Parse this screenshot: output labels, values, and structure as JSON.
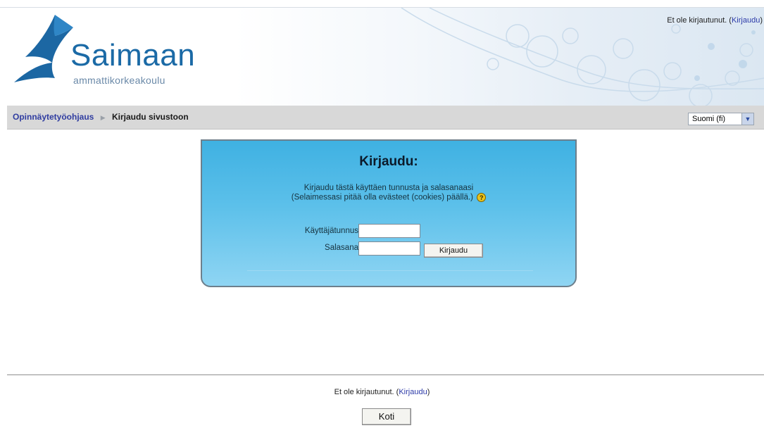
{
  "header": {
    "logo_name": "Saimaan",
    "logo_sub": "ammattikorkeakoulu",
    "login_status": "Et ole kirjautunut.",
    "login_link": "Kirjaudu"
  },
  "navbar": {
    "breadcrumb_home": "Opinnäytetyöohjaus",
    "breadcrumb_current": "Kirjaudu sivustoon",
    "language_value": "Suomi (fi)"
  },
  "login": {
    "title": "Kirjaudu:",
    "description_line1": "Kirjaudu tästä käyttäen tunnusta ja salasanaasi",
    "description_line2": "(Selaimessasi pitää olla evästeet (cookies) päällä.)",
    "username_label": "Käyttäjätunnus",
    "username_value": "",
    "password_label": "Salasana",
    "password_value": "",
    "submit_label": "Kirjaudu",
    "help_icon": "question-mark-icon"
  },
  "footer": {
    "login_status": "Et ole kirjautunut.",
    "login_link": "Kirjaudu",
    "home_button": "Koti"
  },
  "colors": {
    "link": "#2c3aa8",
    "login_box_top": "#3fb1e2",
    "login_box_bottom": "#8fd5f3",
    "logo_blue": "#1b6aa6",
    "navbar_bg": "#d8d8d8"
  }
}
